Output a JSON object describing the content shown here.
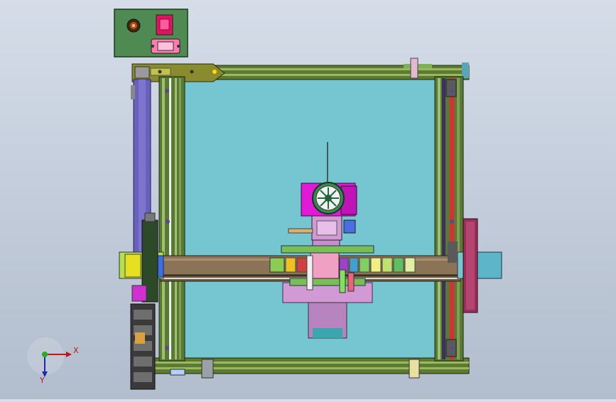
{
  "viewport": {
    "background_top": "#d6dde9",
    "background_bottom": "#b2bdcd",
    "bed_color": "#76c6d2",
    "frame_color": "#6b8a3a",
    "gantry_color": "#8a7356",
    "accent_magenta": "#e01ad6",
    "accent_purple": "#6a61bd",
    "power_switch_color": "#e0135f",
    "control_box_color": "#4f8a52"
  },
  "triad": {
    "x_label": "X",
    "y_label": "Y",
    "icon": "coordinate-triad-icon"
  }
}
